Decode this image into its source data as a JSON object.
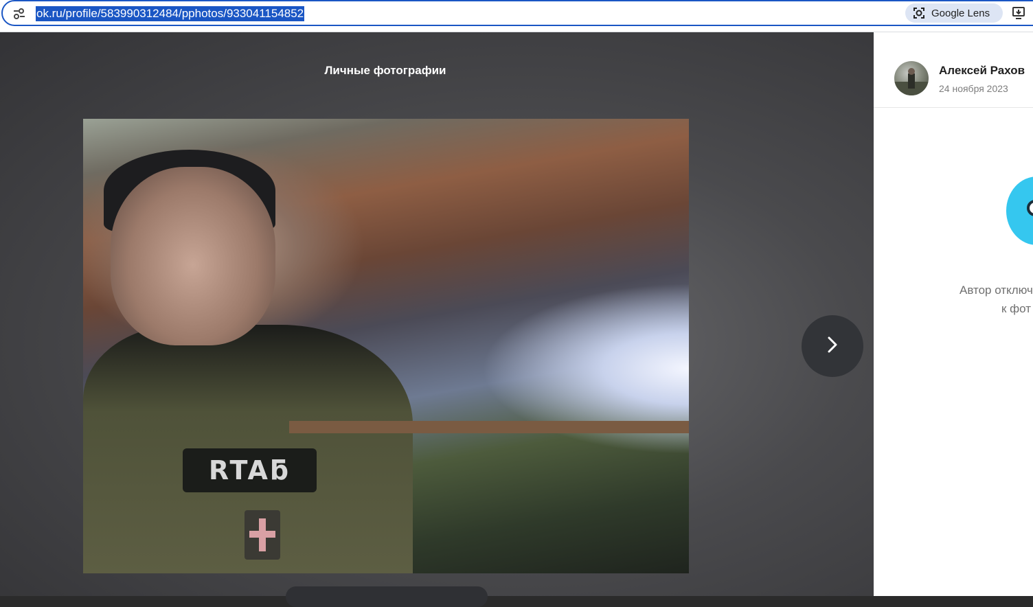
{
  "browser": {
    "url": "ok.ru/profile/583990312484/pphotos/933041154852",
    "lens_label": "Google Lens"
  },
  "viewer": {
    "title": "Личные фотографии",
    "photo_patch_text": "RTAƃ"
  },
  "sidebar": {
    "author_name": "Алексей Рахов",
    "post_date": "24 ноября 2023",
    "comments_off_line1": "Автор отключ",
    "comments_off_line2": "к фот"
  },
  "colors": {
    "accent": "#1a56c4",
    "lens_bg": "#dde5f4",
    "mascot": "#35c7ef"
  },
  "icons": {
    "site_info": "tune-icon",
    "lens": "google-lens-icon",
    "install": "install-app-icon",
    "next": "chevron-right-icon"
  }
}
